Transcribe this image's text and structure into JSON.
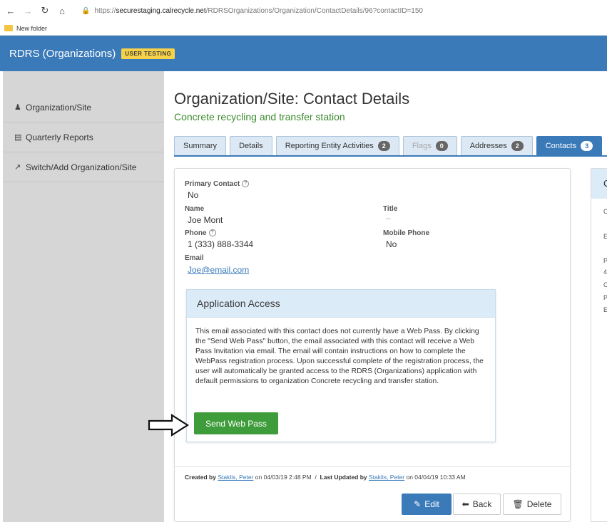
{
  "browser": {
    "url_prefix": "https://",
    "url_host": "securestaging.calrecycle.net",
    "url_path": "/RDRSOrganizations/Organization/ContactDetails/96?contactID=150",
    "bookmark": "New folder"
  },
  "app": {
    "title": "RDRS (Organizations)",
    "env_badge": "USER TESTING",
    "accent_color": "#3a7ab9"
  },
  "sidebar": {
    "items": [
      {
        "label": "Organization/Site",
        "icon": "user-icon"
      },
      {
        "label": "Quarterly Reports",
        "icon": "bar-chart-icon"
      },
      {
        "label": "Switch/Add Organization/Site",
        "icon": "external-link-icon"
      }
    ]
  },
  "page": {
    "title": "Organization/Site: Contact Details",
    "subtitle": "Concrete recycling and transfer station"
  },
  "tabs": [
    {
      "label": "Summary"
    },
    {
      "label": "Details"
    },
    {
      "label": "Reporting Entity Activities",
      "count": "2"
    },
    {
      "label": "Flags",
      "count": "0"
    },
    {
      "label": "Addresses",
      "count": "2"
    },
    {
      "label": "Contacts",
      "count": "3"
    }
  ],
  "contact": {
    "primary_label": "Primary Contact",
    "primary_value": "No",
    "name_label": "Name",
    "name_value": "Joe Mont",
    "title_label": "Title",
    "title_value": "--",
    "phone_label": "Phone",
    "phone_value": "1 (333) 888-3344",
    "mobile_label": "Mobile Phone",
    "mobile_value": "No",
    "email_label": "Email",
    "email_value": "Joe@email.com"
  },
  "access": {
    "heading": "Application Access",
    "body": "This email associated with this contact does not currently have a Web Pass. By clicking the \"Send Web Pass\" button, the email associated with this contact will receive a Web Pass Invitation via email. The email will contain instructions on how to complete the WebPass registration process. Upon successful complete of the registration process, the user will automatically be granted access to the RDRS (Organizations) application with default permissions to organization Concrete recycling and transfer station.",
    "button": "Send Web Pass"
  },
  "audit": {
    "created_label": "Created by",
    "created_by": "Staklis, Peter",
    "created_on": "on 04/03/19 2:48 PM",
    "separator": "/",
    "updated_label": "Last Updated by",
    "updated_by": "Staklis, Peter",
    "updated_on": "on 04/04/19 10:33 AM"
  },
  "actions": {
    "edit": "Edit",
    "back": "Back",
    "delete": "Delete"
  },
  "right_panel": {
    "heading_fragment": "C",
    "fragments": [
      "O",
      "E",
      "P",
      "4",
      "C",
      "P",
      "E"
    ]
  }
}
